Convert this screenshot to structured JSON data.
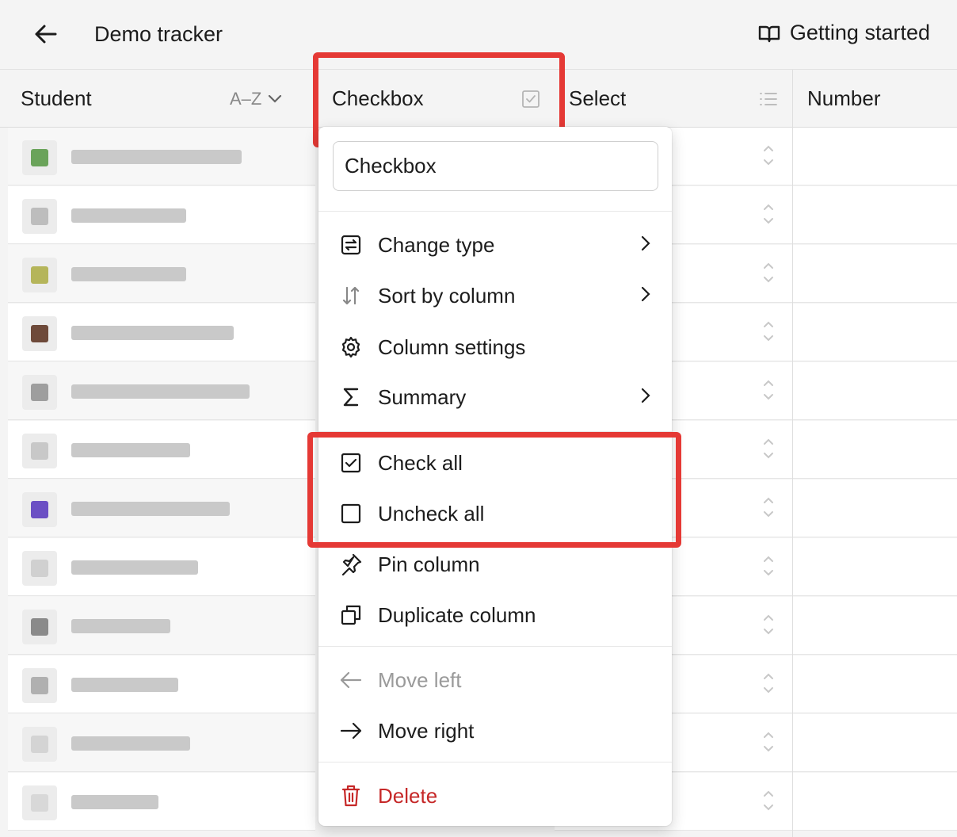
{
  "topbar": {
    "title": "Demo tracker",
    "back_icon": "arrow-left-icon",
    "help_label": "Getting started",
    "help_icon": "book-open-icon"
  },
  "columns": {
    "student": "Student",
    "sort": "A–Z",
    "checkbox": "Checkbox",
    "select": "Select",
    "number": "Number"
  },
  "menu": {
    "rename_value": "Checkbox",
    "items": [
      {
        "label": "Change type",
        "icon": "swap-icon"
      },
      {
        "label": "Sort by column",
        "icon": "sort-icon"
      },
      {
        "label": "Column settings",
        "icon": "gear-icon"
      },
      {
        "label": "Summary",
        "icon": "sigma-icon"
      },
      {
        "label": "Check all",
        "icon": "checked-box-icon"
      },
      {
        "label": "Uncheck all",
        "icon": "empty-box-icon"
      },
      {
        "label": "Pin column",
        "icon": "pin-icon"
      },
      {
        "label": "Duplicate column",
        "icon": "duplicate-icon"
      },
      {
        "label": "Move left",
        "icon": "arrow-left-icon"
      },
      {
        "label": "Move right",
        "icon": "arrow-right-icon"
      },
      {
        "label": "Delete",
        "icon": "trash-icon"
      }
    ]
  },
  "colors": {
    "highlight": "#e53935",
    "danger": "#c62828",
    "disabled": "#9a9a9a"
  }
}
